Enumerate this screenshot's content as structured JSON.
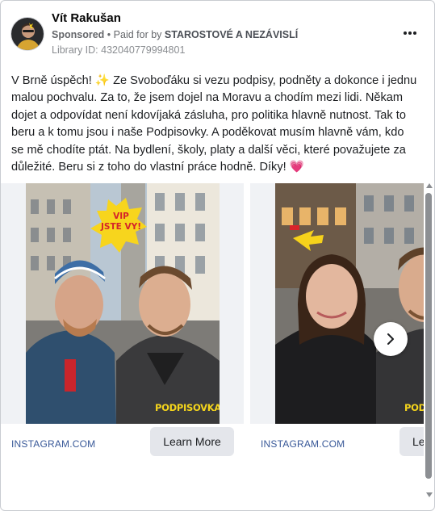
{
  "post": {
    "page_name": "Vít Rakušan",
    "sponsored_label": "Sponsored",
    "separator": "•",
    "paid_for_prefix": "Paid for by",
    "payer": "STAROSTOVÉ A NEZÁVISLÍ",
    "library_id": "Library ID: 432040779994801",
    "more_icon": "more-horizontal-icon",
    "text": {
      "part1": "V Brně úspěch! ",
      "sparkle_emoji": "✨",
      "part2": " Ze Svoboďáku si vezu podpisy, podněty a dokonce i jednu malou pochvalu. Za to, že jsem dojel na Moravu a chodím mezi lidi. Někam dojet a odpovídat není kdovíjaká zásluha, pro politika hlavně nutnost. Tak to beru a k tomu jsou i naše Podpisovky. A poděkovat musím hlavně vám, kdo se mě chodíte ptát. Na bydlení, školy, platy a další věci, které považujete za důležité. Beru si z toho do vlastní práce hodně. Díky! ",
      "heart_emoji": "💗"
    }
  },
  "carousel": {
    "cards": [
      {
        "badge_line1": "VIP",
        "badge_line2": "JSTE VY!",
        "overlay": "PODPISOVKA",
        "domain": "INSTAGRAM.COM",
        "cta": "Learn More"
      },
      {
        "overlay": "PODP",
        "domain": "INSTAGRAM.COM",
        "cta": "Le"
      }
    ],
    "next_icon": "chevron-right-icon"
  },
  "colors": {
    "link": "#385898",
    "badge_yellow": "#f7d51d",
    "badge_text": "#d4242a",
    "overlay_yellow": "#f4d41c",
    "arrow_yellow": "#f6d21b"
  }
}
